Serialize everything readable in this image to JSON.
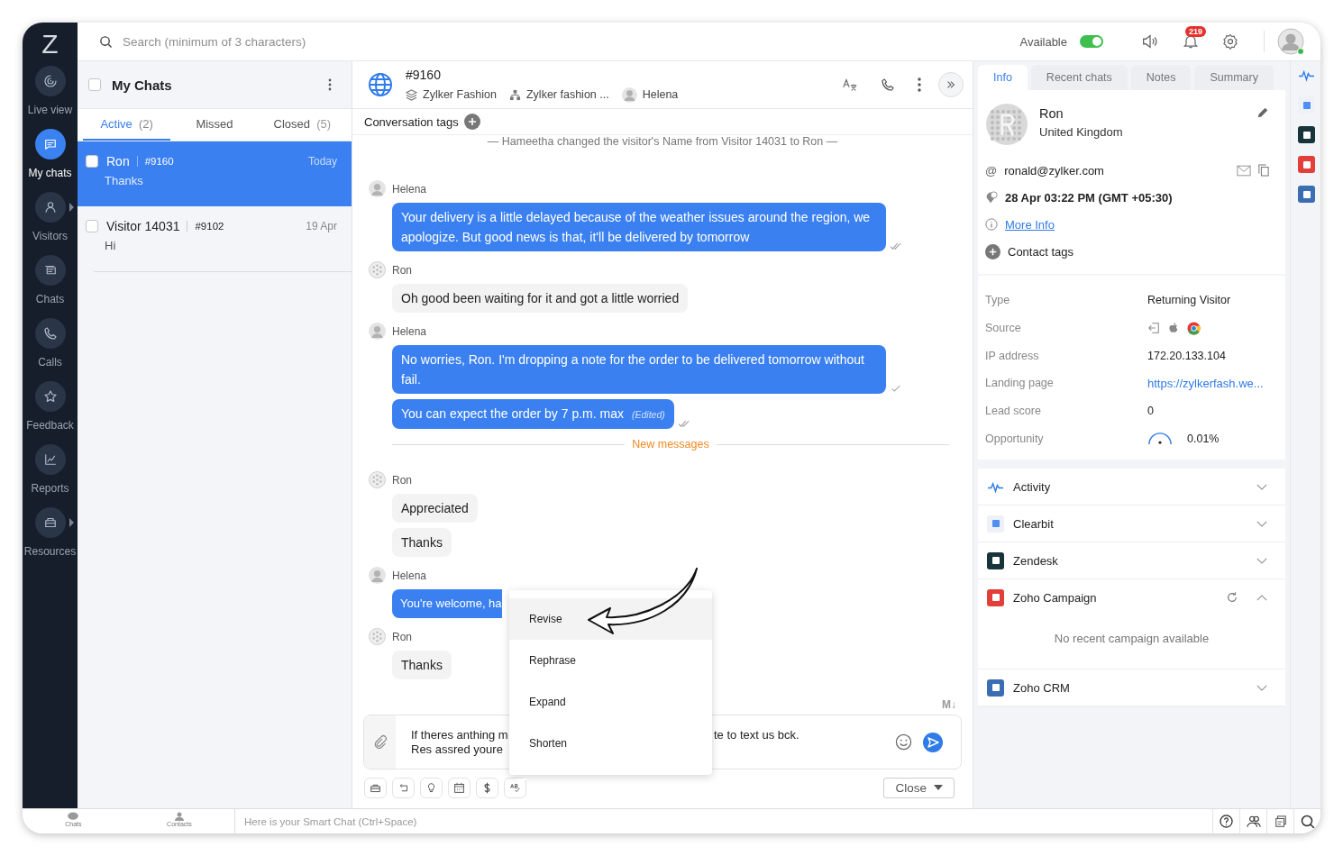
{
  "logo": "Z",
  "top_bar": {
    "search_placeholder": "Search (minimum of 3 characters)",
    "availability": {
      "label": "Available",
      "on": true
    },
    "notification_count": "219"
  },
  "nav": [
    {
      "label": "Live view",
      "selected": false,
      "submenu": false
    },
    {
      "label": "My chats",
      "selected": true,
      "submenu": false
    },
    {
      "label": "Visitors",
      "selected": false,
      "submenu": true
    },
    {
      "label": "Chats",
      "selected": false,
      "submenu": false
    },
    {
      "label": "Calls",
      "selected": false,
      "submenu": false
    },
    {
      "label": "Feedback",
      "selected": false,
      "submenu": false
    },
    {
      "label": "Reports",
      "selected": false,
      "submenu": false
    },
    {
      "label": "Resources",
      "selected": false,
      "submenu": true
    }
  ],
  "chat_list": {
    "title": "My Chats",
    "select_all_checked": false,
    "tabs": [
      {
        "label": "Active",
        "count": "(2)",
        "selected": true
      },
      {
        "label": "Missed",
        "selected": false
      },
      {
        "label": "Closed",
        "count": "(5)",
        "selected": false
      }
    ],
    "items": [
      {
        "name": "Ron",
        "id": "#9160",
        "date": "Today",
        "preview": "Thanks",
        "selected": true,
        "checked": false
      },
      {
        "name": "Visitor 14031",
        "id": "#9102",
        "date": "19 Apr",
        "preview": "Hi",
        "selected": false,
        "checked": false
      }
    ]
  },
  "conversation": {
    "id": "#9160",
    "meta": [
      "Zylker Fashion",
      "Zylker fashion ...",
      "Helena"
    ],
    "tags_label": "Conversation tags",
    "messages": [
      {
        "kind": "system",
        "text": "— Hameetha changed the visitor's Name from Visitor 14031 to Ron —"
      },
      {
        "kind": "agent",
        "sender": "Helena",
        "bubbles": [
          {
            "text": "Your delivery is a little delayed because of the weather issues around the region, we apologize. But good news is that, it'll be delivered by tomorrow",
            "read": true
          }
        ]
      },
      {
        "kind": "visitor",
        "sender": "Ron",
        "bubbles": [
          {
            "text": "Oh good been waiting for it and got a little worried"
          }
        ]
      },
      {
        "kind": "agent",
        "sender": "Helena",
        "bubbles": [
          {
            "text": "No worries, Ron. I'm dropping a note for the order to be delivered tomorrow without fail.",
            "read": false
          },
          {
            "text": "You can expect the order by 7 p.m. max",
            "edited_label": "(Edited)",
            "read": true
          }
        ]
      },
      {
        "kind": "divider",
        "text": "New messages"
      },
      {
        "kind": "visitor",
        "sender": "Ron",
        "bubbles": [
          {
            "text": "Appreciated"
          },
          {
            "text": "Thanks"
          }
        ]
      },
      {
        "kind": "agent",
        "sender": "Helena",
        "bubbles": [
          {
            "text": "You're welcome, ha",
            "cut": true
          }
        ]
      },
      {
        "kind": "visitor",
        "sender": "Ron",
        "bubbles": [
          {
            "text": "Thanks"
          }
        ]
      }
    ],
    "markdown_label": "M↓",
    "composer": {
      "lines": [
        {
          "left": "If theres anthing m",
          "right": "te to text us bck."
        },
        {
          "left": "Res assred youre"
        }
      ]
    },
    "close_button": "Close",
    "rewrite_menu": [
      {
        "label": "Revise",
        "selected": true
      },
      {
        "label": "Rephrase",
        "selected": false
      },
      {
        "label": "Expand",
        "selected": false
      },
      {
        "label": "Shorten",
        "selected": false
      }
    ]
  },
  "info_panel": {
    "tabs": [
      {
        "label": "Info",
        "selected": true
      },
      {
        "label": "Recent chats",
        "selected": false
      },
      {
        "label": "Notes",
        "selected": false
      },
      {
        "label": "Summary",
        "selected": false
      }
    ],
    "name": "Ron",
    "country": "United Kingdom",
    "email_icon": "@",
    "email": "ronald@zylker.com",
    "local_time": "28 Apr 03:22 PM  (GMT +05:30)",
    "more_info": "More Info",
    "contact_tags": "Contact tags",
    "details": [
      {
        "label": "Type",
        "kind": "text",
        "value": "Returning Visitor"
      },
      {
        "label": "Source",
        "kind": "icons"
      },
      {
        "label": "IP address",
        "kind": "text",
        "value": "172.20.133.104"
      },
      {
        "label": "Landing page",
        "kind": "link",
        "value": "https://zylkerfash.we..."
      },
      {
        "label": "Lead score",
        "kind": "text",
        "value": "0"
      },
      {
        "label": "Opportunity",
        "kind": "gauge",
        "value": "0.01%"
      }
    ],
    "integrations": [
      {
        "name": "Activity",
        "expanded": false
      },
      {
        "name": "Clearbit",
        "expanded": false
      },
      {
        "name": "Zendesk",
        "expanded": false
      },
      {
        "name": "Zoho Campaign",
        "expanded": true,
        "empty_text": "No recent campaign available"
      },
      {
        "name": "Zoho CRM",
        "expanded": false
      }
    ]
  },
  "bottom_bar": {
    "tabs": [
      "Chats",
      "Contacts"
    ],
    "smart_chat_placeholder": "Here is your Smart Chat (Ctrl+Space)"
  }
}
